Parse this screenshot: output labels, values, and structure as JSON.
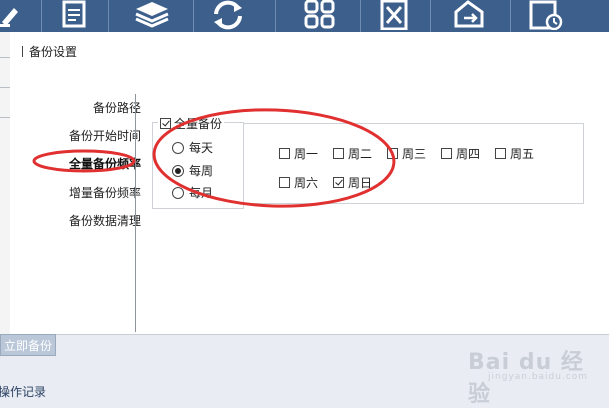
{
  "dialog": {
    "title": "备份设置"
  },
  "nav": {
    "items": [
      {
        "label": "备份路径",
        "active": false
      },
      {
        "label": "备份开始时间",
        "active": false
      },
      {
        "label": "全量备份频率",
        "active": true
      },
      {
        "label": "增量备份频率",
        "active": false
      },
      {
        "label": "备份数据清理",
        "active": false
      }
    ]
  },
  "full_backup": {
    "enable_label": "全量备份",
    "enabled": true,
    "frequency_options": [
      {
        "label": "每天",
        "selected": false
      },
      {
        "label": "每周",
        "selected": true
      },
      {
        "label": "每月",
        "selected": false
      }
    ],
    "days": [
      {
        "label": "周一",
        "checked": false
      },
      {
        "label": "周二",
        "checked": false
      },
      {
        "label": "周三",
        "checked": false
      },
      {
        "label": "周四",
        "checked": false
      },
      {
        "label": "周五",
        "checked": false
      },
      {
        "label": "周六",
        "checked": false
      },
      {
        "label": "周日",
        "checked": true
      }
    ]
  },
  "bottom": {
    "backup_now_label": "立即备份",
    "operation_log_label": "操作记录"
  },
  "watermark": {
    "brand": "Bai du 经验",
    "sub": "jingyan.baidu.com"
  },
  "colors": {
    "toolbar": "#3c5f8c",
    "annotation": "#e03030"
  },
  "icons": [
    "edit-icon",
    "document-icon",
    "layers-icon",
    "sync-icon",
    "grid-icon",
    "tools-icon",
    "tag-icon",
    "calendar-clock-icon"
  ]
}
